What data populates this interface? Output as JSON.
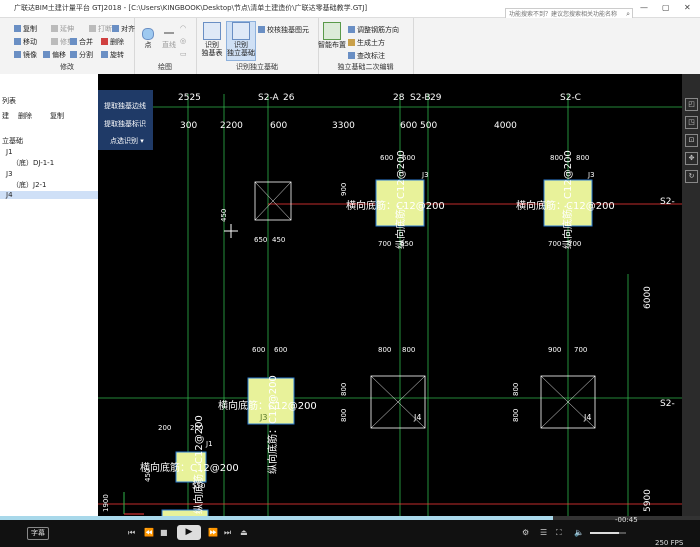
{
  "window": {
    "title": "广联达BIM土建计量平台 GTJ2018 - [C:\\Users\\KINGBOOK\\Desktop\\节点\\清单土建造价\\广联达零基础教学.GTJ]",
    "search_placeholder": "功能搜索不到？建议您搜索相关功能名称"
  },
  "ribbon": {
    "modify": {
      "label": "修改",
      "items": [
        "复制",
        "延伸",
        "打断",
        "对齐",
        "移动",
        "修剪",
        "合并",
        "删除",
        "镜像",
        "偏移",
        "分割",
        "旋转"
      ]
    },
    "draw": {
      "label": "绘图",
      "point": "点",
      "line": "直线"
    },
    "identify": {
      "label": "识别独立基础",
      "table_btn": "识别\n独基表",
      "identify_btn": "识别\n独立基础",
      "check_btn": "校核独基图元"
    },
    "edit2": {
      "label": "独立基础二次编辑",
      "smart_layout": "智能布置",
      "items": [
        "调整钢筋方向",
        "生成土方",
        "查改标注"
      ]
    }
  },
  "left_panel": {
    "title": "列表",
    "toolbar": [
      "建",
      "删除",
      "复制"
    ],
    "tree": [
      {
        "label": "立基础",
        "indent": 0
      },
      {
        "label": "J1",
        "indent": 1
      },
      {
        "label": "（底）DJ-1-1",
        "indent": 2
      },
      {
        "label": "J3",
        "indent": 1
      },
      {
        "label": "（底）J2-1",
        "indent": 2
      },
      {
        "label": "J4",
        "indent": 1,
        "selected": true
      }
    ]
  },
  "float_panel": {
    "buttons": [
      "提取独基边线",
      "提取独基标识",
      "点选识别"
    ]
  },
  "cad": {
    "axis_labels": [
      "2525",
      "S2-A",
      "26",
      "28",
      "S2-B",
      "29",
      "S2-C",
      "S2-",
      "S2-"
    ],
    "top_dims": [
      "300",
      "2200",
      "600",
      "3300",
      "600",
      "500",
      "4000"
    ],
    "right_dims": [
      "6000",
      "5900"
    ],
    "footing_tags": [
      "J3",
      "J3",
      "J3",
      "J4",
      "J4",
      "J1"
    ],
    "rebar_x": "横向底筋：C12@200",
    "rebar_y": "纵向底筋：C12@200",
    "small_dims": [
      "600",
      "600",
      "800",
      "800",
      "900",
      "700",
      "450",
      "650",
      "450",
      "650",
      "700",
      "700",
      "600",
      "600",
      "800",
      "800",
      "900",
      "700",
      "800",
      "800",
      "800",
      "800",
      "200",
      "200",
      "450",
      "550",
      "1900",
      "450"
    ]
  },
  "video": {
    "subtitle_btn": "字幕",
    "time": "-00:45",
    "fps": "250 FPS",
    "progress": 0.79,
    "volume": 0.8
  },
  "colors": {
    "canvas": "#000000",
    "footing_fill": "#e8f29a",
    "footing_outline": "#2b7cd3",
    "dim_color": "#ffffff",
    "axis_line": "#ff3b3b",
    "grid_green": "#2fb34a",
    "float_panel": "#1f3a67"
  }
}
